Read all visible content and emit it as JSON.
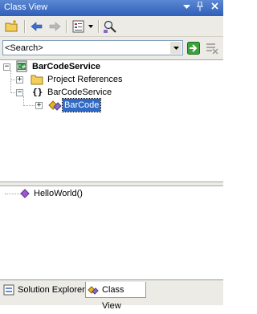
{
  "window": {
    "title": "Class View"
  },
  "search": {
    "value": "<Search>"
  },
  "tree": {
    "root": "BarCodeService",
    "project_references": "Project References",
    "namespace": "BarCodeService",
    "namespace_glyph": "{}",
    "class_item": "BarCode"
  },
  "members": {
    "item": "HelloWorld()"
  },
  "tabs": [
    {
      "label": "Solution Explorer",
      "active": false
    },
    {
      "label": "Class View",
      "active": true
    }
  ],
  "colors": {
    "titlebar": "#2f5fb8",
    "selection": "#316ac5",
    "toolbar": "#ecebe6"
  },
  "icons": {
    "new_folder": "new-folder-icon",
    "back": "back-arrow-icon",
    "forward": "forward-arrow-icon",
    "view_options": "view-options-icon",
    "find_symbol": "find-symbol-icon",
    "go": "go-arrow-icon",
    "clear": "clear-search-icon"
  }
}
